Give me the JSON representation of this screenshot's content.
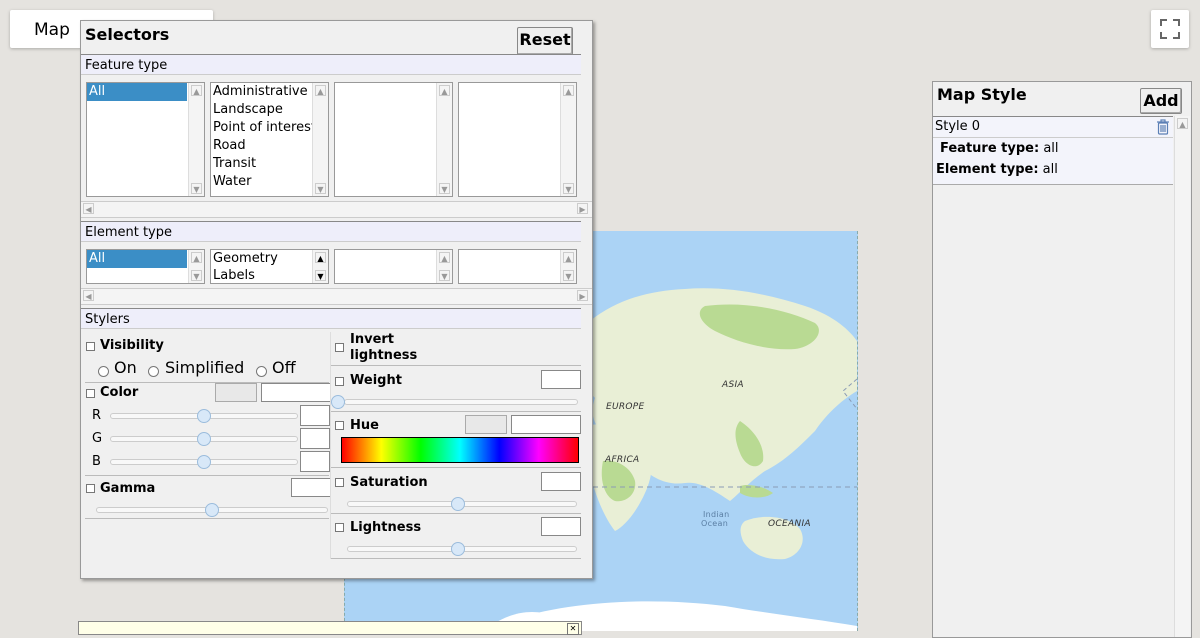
{
  "map_tab": {
    "label": "Map"
  },
  "fullscreen": {
    "icon": "fullscreen-icon"
  },
  "map": {
    "labels": {
      "asia": "ASIA",
      "europe": "EUROPE",
      "africa": "AFRICA",
      "indian1": "Indian",
      "indian2": "Ocean",
      "oceania": "OCEANIA"
    },
    "colors": {
      "water": "#abd3f5",
      "land": "#e9efd6",
      "green": "#b9da93"
    }
  },
  "selectors": {
    "title": "Selectors",
    "reset_label": "Reset",
    "feature_type": {
      "heading": "Feature type",
      "col1": [
        {
          "label": "All",
          "selected": true
        }
      ],
      "col2": [
        "Administrative",
        "Landscape",
        "Point of interest",
        "Road",
        "Transit",
        "Water"
      ]
    },
    "element_type": {
      "heading": "Element type",
      "col1": [
        {
          "label": "All",
          "selected": true
        }
      ],
      "col2": [
        "Geometry",
        "Labels"
      ]
    },
    "stylers": {
      "heading": "Stylers",
      "visibility": {
        "label": "Visibility",
        "options": [
          "On",
          "Simplified",
          "Off"
        ]
      },
      "color": {
        "label": "Color",
        "channels": [
          "R",
          "G",
          "B"
        ],
        "levels": [
          0.5,
          0.5,
          0.5
        ]
      },
      "gamma": {
        "label": "Gamma",
        "level": 0.5
      },
      "invert_lightness": {
        "line1": "Invert",
        "line2": "lightness"
      },
      "weight": {
        "label": "Weight",
        "level": 0
      },
      "hue": {
        "label": "Hue"
      },
      "saturation": {
        "label": "Saturation",
        "level": 0.5
      },
      "lightness": {
        "label": "Lightness",
        "level": 0.5
      }
    }
  },
  "map_style": {
    "title": "Map Style",
    "add_label": "Add",
    "style_name": "Style 0",
    "delete_icon": "trash-icon",
    "feature_type_label": "Feature type:",
    "feature_type_value": "all",
    "element_type_label": "Element type:",
    "element_type_value": "all"
  }
}
